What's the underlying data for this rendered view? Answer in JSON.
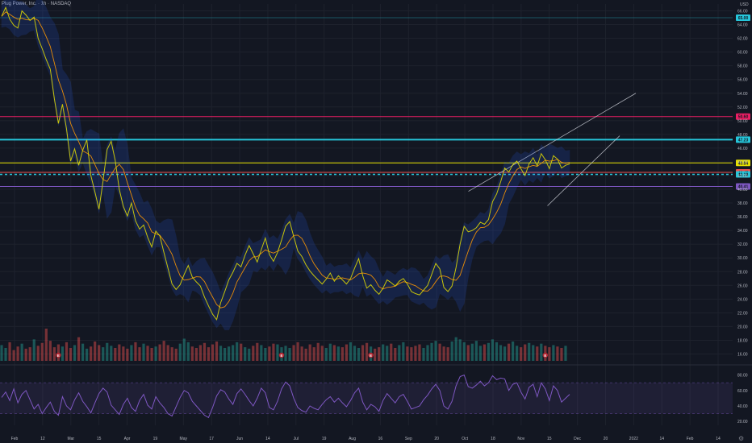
{
  "symbol": {
    "name": "Plug Power, Inc.",
    "interval": "1h",
    "exchange": "NASDAQ"
  },
  "currency": "USD",
  "colors": {
    "background": "#131722",
    "grid": "#1e222d",
    "axis_text": "#b2b5be",
    "price_line": "#e6e100",
    "bands": "#2962ff",
    "ma": "#ff9800",
    "rsi": "#7e57c2",
    "resistance_high": "#e91e63",
    "resistance_cyan": "#26c6da",
    "support_purple": "#7e57c2",
    "channel": "#d1d4dc",
    "volume_up": "#26a69a",
    "volume_down": "#ef5350"
  },
  "chart_data": [
    {
      "type": "line",
      "pane": "price",
      "y_ticks": [
        16,
        18,
        20,
        22,
        24,
        26,
        28,
        30,
        32,
        34,
        36,
        38,
        40,
        42,
        44,
        46,
        48,
        50,
        52,
        54,
        56,
        58,
        60,
        62,
        64,
        66
      ],
      "ylim": [
        15,
        67
      ],
      "x_ticks": [
        "Feb",
        "12",
        "Mar",
        "15",
        "Apr",
        "19",
        "May",
        "17",
        "Jun",
        "14",
        "Jul",
        "19",
        "Aug",
        "16",
        "Sep",
        "20",
        "Oct",
        "18",
        "Nov",
        "15",
        "Dec",
        "20",
        "2022",
        "14",
        "Feb",
        "14"
      ],
      "price_series": [
        65.2,
        66.5,
        64.8,
        63.9,
        63.5,
        66.0,
        65.4,
        64.6,
        65.1,
        62.0,
        60.5,
        58.9,
        57.5,
        53.2,
        49.6,
        52.4,
        48.8,
        44.1,
        45.9,
        43.5,
        45.7,
        47.2,
        42.0,
        39.6,
        37.1,
        41.2,
        45.8,
        47.0,
        44.2,
        40.0,
        37.5,
        36.1,
        38.0,
        35.4,
        34.2,
        34.8,
        33.0,
        31.6,
        33.9,
        33.2,
        30.8,
        28.5,
        26.2,
        25.4,
        26.1,
        27.6,
        28.9,
        27.2,
        26.5,
        25.9,
        24.3,
        23.0,
        21.8,
        21.0,
        23.5,
        25.1,
        26.8,
        27.9,
        29.2,
        28.7,
        30.4,
        31.8,
        30.6,
        29.4,
        31.2,
        32.9,
        30.5,
        29.5,
        30.8,
        32.6,
        34.6,
        35.3,
        33.1,
        31.0,
        30.2,
        29.0,
        28.1,
        27.4,
        26.8,
        26.2,
        26.9,
        27.8,
        26.6,
        27.4,
        26.8,
        26.2,
        27.0,
        28.5,
        29.9,
        27.4,
        25.6,
        26.1,
        25.3,
        24.7,
        25.6,
        26.8,
        26.4,
        25.9,
        26.6,
        27.0,
        26.2,
        25.1,
        24.8,
        24.6,
        25.3,
        26.0,
        27.6,
        29.2,
        28.4,
        25.7,
        25.1,
        25.9,
        28.6,
        32.0,
        34.6,
        33.8,
        34.0,
        34.4,
        35.2,
        34.9,
        35.6,
        38.2,
        39.3,
        41.1,
        43.1,
        42.5,
        43.6,
        44.1,
        43.0,
        42.0,
        43.7,
        44.6,
        43.4,
        45.2,
        44.3,
        43.0,
        44.9,
        44.4,
        43.1,
        43.5,
        43.7
      ],
      "volume_series": [
        22,
        18,
        26,
        15,
        20,
        24,
        17,
        19,
        30,
        21,
        25,
        45,
        28,
        19,
        23,
        20,
        26,
        18,
        22,
        33,
        24,
        17,
        20,
        27,
        22,
        19,
        25,
        21,
        18,
        23,
        20,
        17,
        22,
        26,
        19,
        24,
        21,
        18,
        20,
        23,
        28,
        22,
        19,
        17,
        24,
        31,
        26,
        20,
        18,
        22,
        25,
        19,
        23,
        27,
        21,
        18,
        20,
        22,
        26,
        24,
        19,
        17,
        21,
        25,
        22,
        18,
        20,
        24,
        23,
        19,
        21,
        18,
        22,
        26,
        20,
        17,
        23,
        19,
        25,
        21,
        18,
        24,
        22,
        20,
        19,
        23,
        26,
        21,
        18,
        22,
        25,
        20,
        17,
        19,
        23,
        21,
        24,
        18,
        22,
        26,
        20,
        19,
        21,
        23,
        18,
        22,
        25,
        28,
        24,
        20,
        19,
        27,
        33,
        30,
        26,
        22,
        24,
        28,
        21,
        23,
        25,
        30,
        26,
        22,
        20,
        24,
        27,
        21,
        19,
        23,
        25,
        22,
        20,
        24,
        21,
        19,
        22,
        20,
        18,
        21
      ],
      "horizontal_levels": [
        {
          "price": 50.6,
          "label": "50.60",
          "color": "#e91e63",
          "style": "solid"
        },
        {
          "price": 47.23,
          "label": "47.23",
          "color": "#26c6da",
          "style": "solid-thick"
        },
        {
          "price": 43.84,
          "label": "43.84",
          "color": "#e6e100",
          "style": "solid"
        },
        {
          "price": 42.47,
          "label": "42.47",
          "color": "#ef5350",
          "style": "solid"
        },
        {
          "price": 42.18,
          "label": "42.18",
          "color": "#26c6da",
          "style": "dotted"
        },
        {
          "price": 40.41,
          "label": "40.41",
          "color": "#7e57c2",
          "style": "solid"
        },
        {
          "price": 65.0,
          "label": "65.00",
          "color": "#26c6da",
          "style": "faint"
        }
      ],
      "event_markers": [
        {
          "label": "E",
          "index": 14
        },
        {
          "label": "E",
          "index": 69
        },
        {
          "label": "E",
          "index": 91
        },
        {
          "label": "E",
          "index": 134
        }
      ]
    },
    {
      "type": "line",
      "pane": "rsi",
      "y_ticks": [
        20,
        40,
        60,
        80
      ],
      "ylim": [
        15,
        90
      ],
      "band": [
        30,
        70
      ],
      "values": [
        51,
        58,
        47,
        62,
        44,
        55,
        60,
        48,
        36,
        42,
        30,
        38,
        45,
        33,
        28,
        52,
        40,
        35,
        48,
        57,
        46,
        39,
        31,
        44,
        56,
        63,
        58,
        41,
        35,
        29,
        42,
        50,
        38,
        33,
        47,
        55,
        41,
        36,
        52,
        44,
        38,
        30,
        27,
        39,
        51,
        60,
        57,
        46,
        40,
        34,
        28,
        25,
        38,
        53,
        61,
        58,
        49,
        42,
        56,
        62,
        55,
        47,
        40,
        50,
        63,
        57,
        38,
        35,
        46,
        62,
        71,
        66,
        50,
        38,
        34,
        32,
        40,
        37,
        35,
        42,
        48,
        52,
        45,
        50,
        44,
        39,
        47,
        57,
        63,
        45,
        35,
        42,
        39,
        33,
        47,
        56,
        50,
        44,
        52,
        55,
        46,
        36,
        38,
        40,
        48,
        54,
        62,
        68,
        60,
        40,
        36,
        46,
        66,
        78,
        80,
        65,
        63,
        67,
        72,
        66,
        70,
        79,
        74,
        76,
        75,
        60,
        68,
        70,
        58,
        49,
        64,
        68,
        52,
        70,
        62,
        47,
        66,
        60,
        45,
        50,
        55
      ]
    }
  ]
}
